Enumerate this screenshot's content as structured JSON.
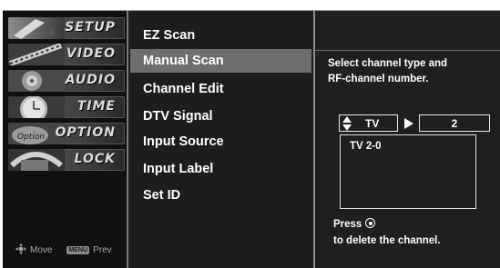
{
  "rail": {
    "tabs": [
      {
        "label": "SETUP",
        "icon": "setup-icon"
      },
      {
        "label": "VIDEO",
        "icon": "video-icon"
      },
      {
        "label": "AUDIO",
        "icon": "audio-icon"
      },
      {
        "label": "TIME",
        "icon": "time-icon"
      },
      {
        "label": "OPTION",
        "icon": "option-icon"
      },
      {
        "label": "LOCK",
        "icon": "lock-icon"
      }
    ],
    "footer": {
      "move_label": "Move",
      "menu_chip": "MENU",
      "prev_label": "Prev"
    }
  },
  "menu": {
    "items": [
      {
        "label": "EZ Scan"
      },
      {
        "label": "Manual Scan",
        "selected": true
      },
      {
        "label": "Channel Edit"
      },
      {
        "label": "DTV Signal"
      },
      {
        "label": "Input Source"
      },
      {
        "label": "Input Label"
      },
      {
        "label": "Set ID"
      }
    ]
  },
  "info": {
    "description_line1": "Select channel type and",
    "description_line2": "RF-channel number.",
    "channel_type": "TV",
    "rf_channel": "2",
    "list_items": [
      "TV 2-0"
    ],
    "press_label": "Press",
    "press_action": "to delete the channel."
  },
  "colors": {
    "background": "#1a1a1a",
    "selected_row": "#6e6e6e",
    "text": "#ffffff"
  }
}
